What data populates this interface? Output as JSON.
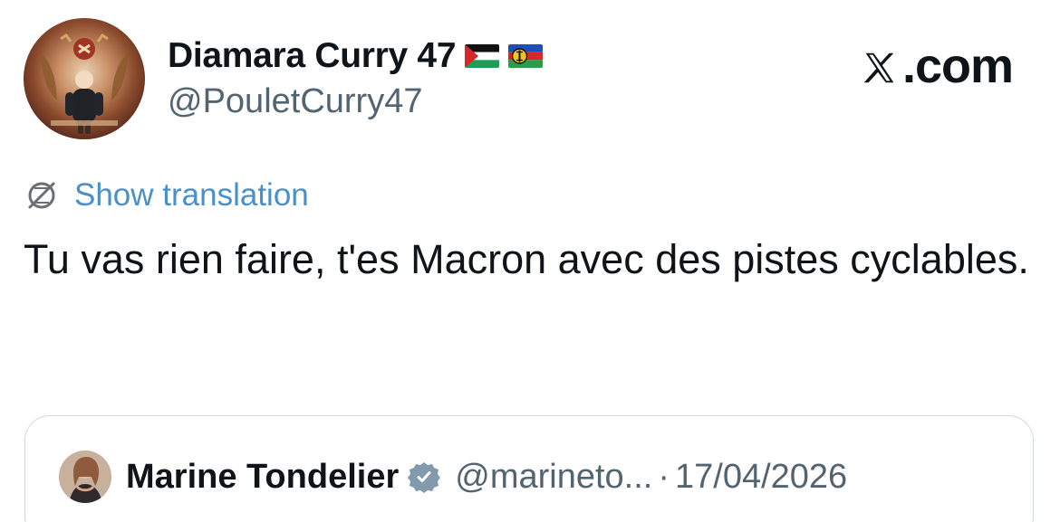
{
  "author": {
    "display_name": "Diamara Curry 47",
    "handle": "@PouletCurry47",
    "avatar": "soviet-emblem-avatar",
    "flags": [
      "palestine-flag",
      "kanak-flag"
    ]
  },
  "brand": {
    "logo": "x-logo",
    "suffix": ".com"
  },
  "translation": {
    "icon": "translate-icon",
    "label": "Show translation"
  },
  "tweet": {
    "text": "Tu vas rien faire, t'es Macron avec des pistes cyclables."
  },
  "quoted": {
    "avatar": "marine-tondelier-avatar",
    "display_name": "Marine Tondelier",
    "verified_icon": "verified-badge-icon",
    "handle": "@marineto...",
    "separator": "·",
    "date": "17/04/2026"
  },
  "colors": {
    "text": "#0f1419",
    "secondary": "#536471",
    "link": "#4a90c8",
    "border": "#cfd9de",
    "background": "#ffffff"
  }
}
